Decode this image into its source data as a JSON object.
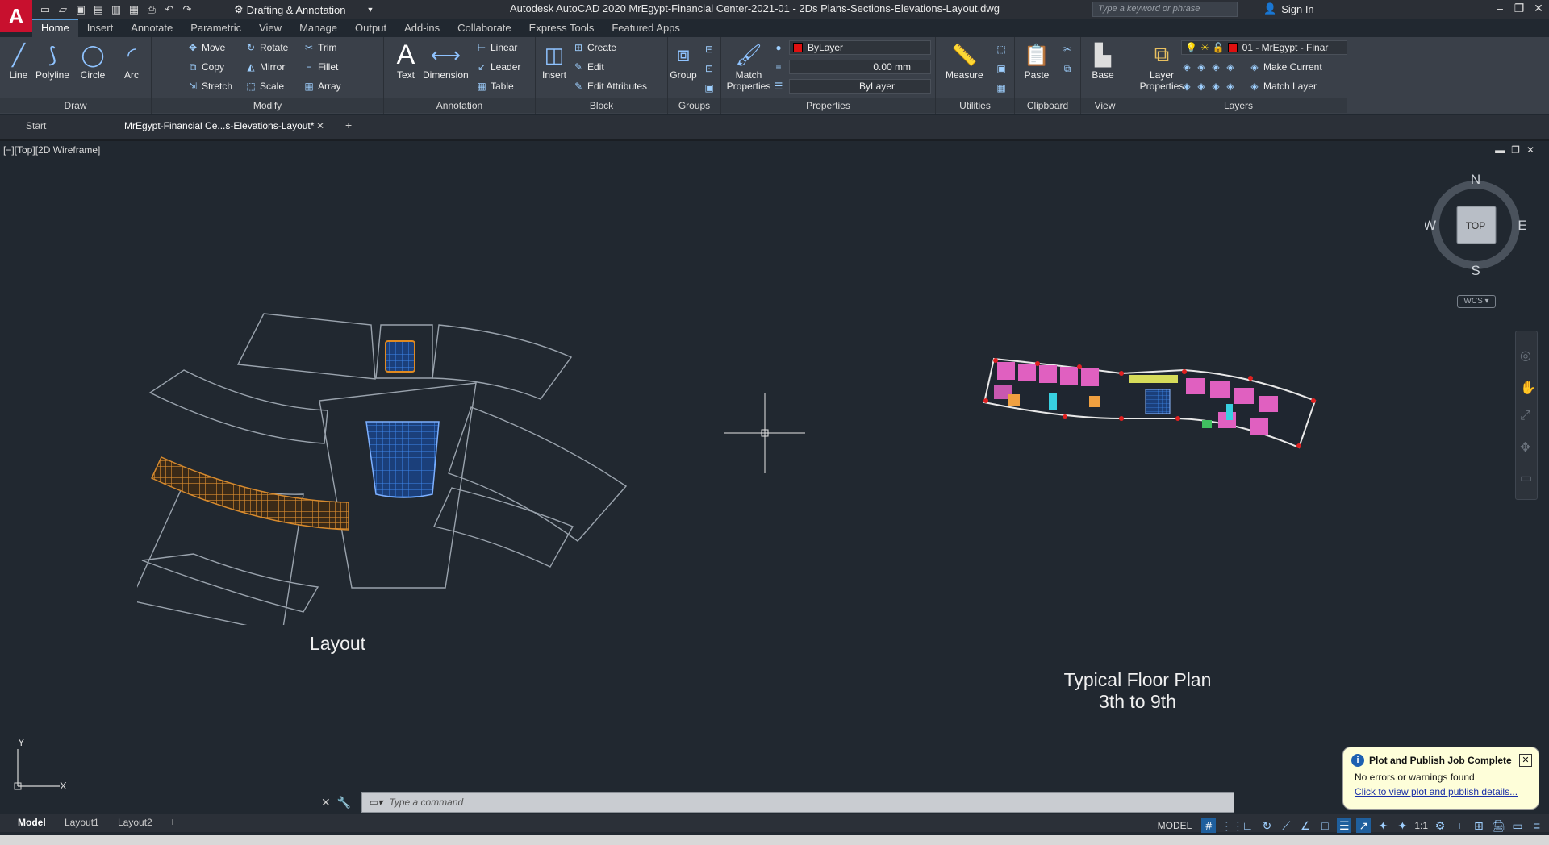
{
  "app": {
    "logo_letter": "A",
    "workspace": "Drafting & Annotation",
    "window_title": "Autodesk AutoCAD 2020   MrEgypt-Financial Center-2021-01 - 2Ds Plans-Sections-Elevations-Layout.dwg",
    "search_placeholder": "Type a keyword or phrase",
    "sign_in": "Sign In"
  },
  "ribbon_tabs": [
    "Home",
    "Insert",
    "Annotate",
    "Parametric",
    "View",
    "Manage",
    "Output",
    "Add-ins",
    "Collaborate",
    "Express Tools",
    "Featured Apps"
  ],
  "draw_panel": {
    "title": "Draw",
    "line": "Line",
    "polyline": "Polyline",
    "circle": "Circle",
    "arc": "Arc"
  },
  "modify_panel": {
    "title": "Modify",
    "move": "Move",
    "rotate": "Rotate",
    "trim": "Trim",
    "copy": "Copy",
    "mirror": "Mirror",
    "fillet": "Fillet",
    "stretch": "Stretch",
    "scale": "Scale",
    "array": "Array"
  },
  "annotation_panel": {
    "title": "Annotation",
    "text": "Text",
    "dimension": "Dimension",
    "linear": "Linear",
    "leader": "Leader",
    "table": "Table"
  },
  "block_panel": {
    "title": "Block",
    "insert": "Insert",
    "create": "Create",
    "edit": "Edit",
    "edit_attributes": "Edit Attributes"
  },
  "groups_panel": {
    "title": "Groups",
    "group": "Group"
  },
  "properties_panel": {
    "title": "Properties",
    "match": "Match Properties",
    "color": "ByLayer",
    "lineweight": "0.00 mm",
    "linetype": "ByLayer"
  },
  "utilities_panel": {
    "title": "Utilities",
    "measure": "Measure"
  },
  "clipboard_panel": {
    "title": "Clipboard",
    "paste": "Paste"
  },
  "view_panel": {
    "title": "View",
    "base": "Base"
  },
  "layers_panel": {
    "title": "Layers",
    "layer_properties": "Layer Properties",
    "current_layer": "01 - MrEgypt - Finar",
    "make_current": "Make Current",
    "match_layer": "Match Layer"
  },
  "doc_tabs": {
    "start": "Start",
    "active": "MrEgypt-Financial Ce...s-Elevations-Layout*"
  },
  "viewport": {
    "label": "[−][Top][2D Wireframe]",
    "layout_caption": "Layout",
    "floor_caption_line1": "Typical Floor Plan",
    "floor_caption_line2": "3th to 9th"
  },
  "viewcube": {
    "n": "N",
    "s": "S",
    "e": "E",
    "w": "W",
    "top": "TOP",
    "wcs": "WCS"
  },
  "ucs": {
    "x": "X",
    "y": "Y"
  },
  "command": {
    "placeholder": "Type  a  command"
  },
  "layout_tabs": [
    "Model",
    "Layout1",
    "Layout2"
  ],
  "status": {
    "model": "MODEL",
    "scale": "1:1"
  },
  "notification": {
    "title": "Plot and Publish Job Complete",
    "line": "No errors or warnings found",
    "link": "Click to view plot and publish details..."
  },
  "colors": {
    "accent": "#5b9bd5",
    "logo": "#c8102e",
    "canvas": "#212830",
    "outline": "#9aa3ad",
    "hatch_orange": "#d68a2e",
    "hatch_blue": "#2f6fd0"
  }
}
